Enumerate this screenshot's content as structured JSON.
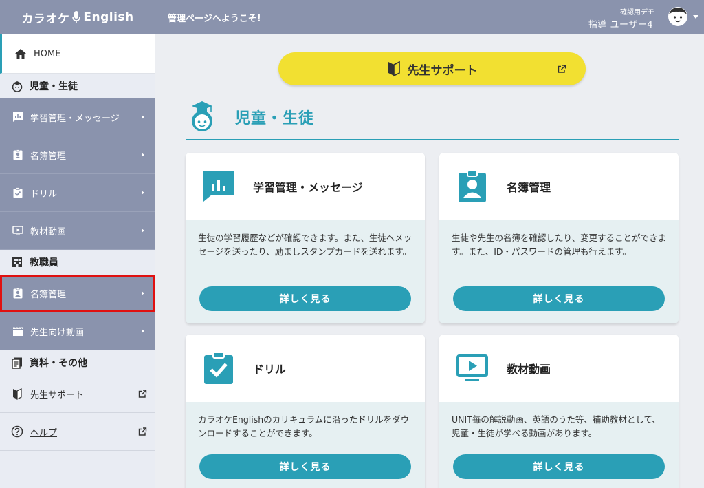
{
  "app": {
    "logo_left": "カラオケ",
    "logo_right": "English"
  },
  "header": {
    "welcome": "管理ページへようこそ!",
    "demo_label": "確認用デモ",
    "user_name": "指導 ユーザー4"
  },
  "sidebar": {
    "home": "HOME",
    "sections": [
      {
        "title": "児童・生徒",
        "items": [
          {
            "label": "学習管理・メッセージ"
          },
          {
            "label": "名簿管理"
          },
          {
            "label": "ドリル"
          },
          {
            "label": "教材動画"
          }
        ]
      },
      {
        "title": "教職員",
        "items": [
          {
            "label": "名簿管理"
          },
          {
            "label": "先生向け動画"
          }
        ]
      },
      {
        "title": "資料・その他",
        "items": [
          {
            "label": "先生サポート"
          },
          {
            "label": "ヘルプ"
          }
        ]
      }
    ]
  },
  "main": {
    "support_button": "先生サポート",
    "page_title": "児童・生徒",
    "cards": [
      {
        "title": "学習管理・メッセージ",
        "desc": "生徒の学習履歴などが確認できます。また、生徒へメッセージを送ったり、励ましスタンプカードを送れます。",
        "button": "詳しく見る"
      },
      {
        "title": "名簿管理",
        "desc": "生徒や先生の名簿を確認したり、変更することができます。また、ID・パスワードの管理も行えます。",
        "button": "詳しく見る"
      },
      {
        "title": "ドリル",
        "desc": "カラオケEnglishのカリキュラムに沿ったドリルをダウンロードすることができます。",
        "button": "詳しく見る"
      },
      {
        "title": "教材動画",
        "desc": "UNIT毎の解説動画、英語のうた等、補助教材として、児童・生徒が学べる動画があります。",
        "button": "詳しく見る"
      }
    ]
  },
  "colors": {
    "accent": "#2a9fb6",
    "nav": "#8a93ad",
    "support": "#f2e031",
    "highlight": "#e01010"
  }
}
